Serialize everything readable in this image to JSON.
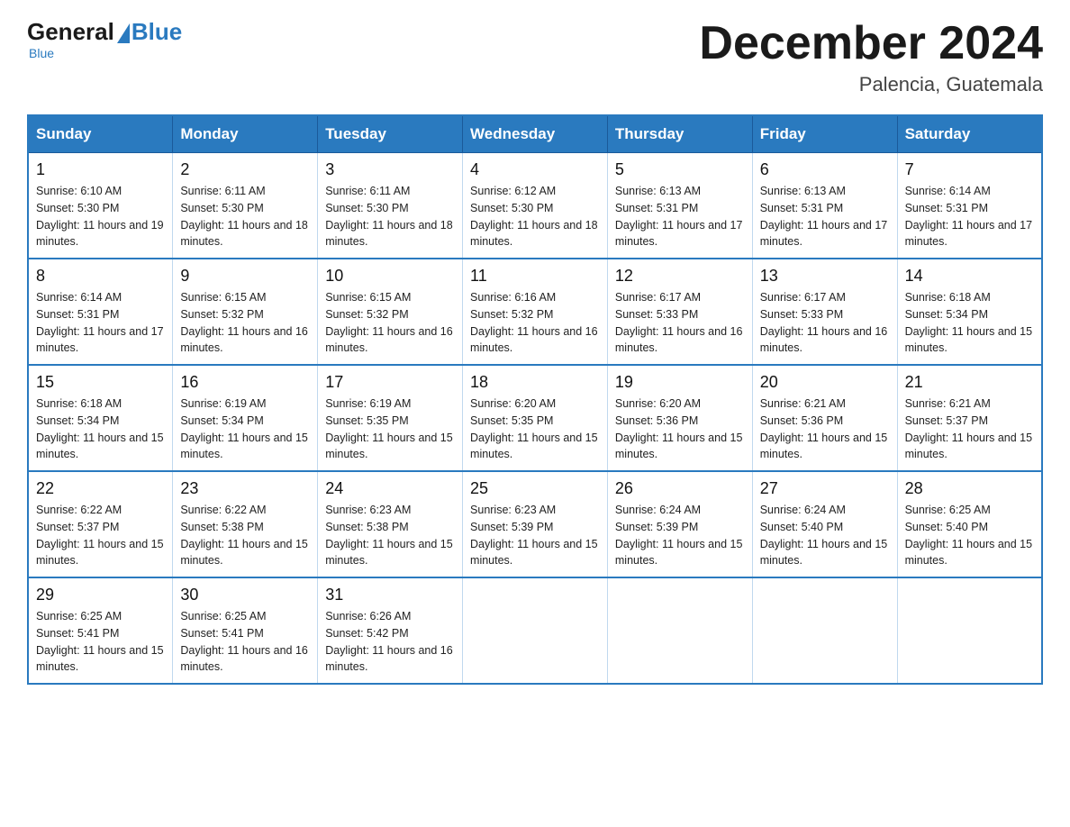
{
  "logo": {
    "general": "General",
    "blue": "Blue"
  },
  "title": "December 2024",
  "location": "Palencia, Guatemala",
  "days_header": [
    "Sunday",
    "Monday",
    "Tuesday",
    "Wednesday",
    "Thursday",
    "Friday",
    "Saturday"
  ],
  "weeks": [
    [
      {
        "day": "1",
        "sunrise": "6:10 AM",
        "sunset": "5:30 PM",
        "daylight": "11 hours and 19 minutes."
      },
      {
        "day": "2",
        "sunrise": "6:11 AM",
        "sunset": "5:30 PM",
        "daylight": "11 hours and 18 minutes."
      },
      {
        "day": "3",
        "sunrise": "6:11 AM",
        "sunset": "5:30 PM",
        "daylight": "11 hours and 18 minutes."
      },
      {
        "day": "4",
        "sunrise": "6:12 AM",
        "sunset": "5:30 PM",
        "daylight": "11 hours and 18 minutes."
      },
      {
        "day": "5",
        "sunrise": "6:13 AM",
        "sunset": "5:31 PM",
        "daylight": "11 hours and 17 minutes."
      },
      {
        "day": "6",
        "sunrise": "6:13 AM",
        "sunset": "5:31 PM",
        "daylight": "11 hours and 17 minutes."
      },
      {
        "day": "7",
        "sunrise": "6:14 AM",
        "sunset": "5:31 PM",
        "daylight": "11 hours and 17 minutes."
      }
    ],
    [
      {
        "day": "8",
        "sunrise": "6:14 AM",
        "sunset": "5:31 PM",
        "daylight": "11 hours and 17 minutes."
      },
      {
        "day": "9",
        "sunrise": "6:15 AM",
        "sunset": "5:32 PM",
        "daylight": "11 hours and 16 minutes."
      },
      {
        "day": "10",
        "sunrise": "6:15 AM",
        "sunset": "5:32 PM",
        "daylight": "11 hours and 16 minutes."
      },
      {
        "day": "11",
        "sunrise": "6:16 AM",
        "sunset": "5:32 PM",
        "daylight": "11 hours and 16 minutes."
      },
      {
        "day": "12",
        "sunrise": "6:17 AM",
        "sunset": "5:33 PM",
        "daylight": "11 hours and 16 minutes."
      },
      {
        "day": "13",
        "sunrise": "6:17 AM",
        "sunset": "5:33 PM",
        "daylight": "11 hours and 16 minutes."
      },
      {
        "day": "14",
        "sunrise": "6:18 AM",
        "sunset": "5:34 PM",
        "daylight": "11 hours and 15 minutes."
      }
    ],
    [
      {
        "day": "15",
        "sunrise": "6:18 AM",
        "sunset": "5:34 PM",
        "daylight": "11 hours and 15 minutes."
      },
      {
        "day": "16",
        "sunrise": "6:19 AM",
        "sunset": "5:34 PM",
        "daylight": "11 hours and 15 minutes."
      },
      {
        "day": "17",
        "sunrise": "6:19 AM",
        "sunset": "5:35 PM",
        "daylight": "11 hours and 15 minutes."
      },
      {
        "day": "18",
        "sunrise": "6:20 AM",
        "sunset": "5:35 PM",
        "daylight": "11 hours and 15 minutes."
      },
      {
        "day": "19",
        "sunrise": "6:20 AM",
        "sunset": "5:36 PM",
        "daylight": "11 hours and 15 minutes."
      },
      {
        "day": "20",
        "sunrise": "6:21 AM",
        "sunset": "5:36 PM",
        "daylight": "11 hours and 15 minutes."
      },
      {
        "day": "21",
        "sunrise": "6:21 AM",
        "sunset": "5:37 PM",
        "daylight": "11 hours and 15 minutes."
      }
    ],
    [
      {
        "day": "22",
        "sunrise": "6:22 AM",
        "sunset": "5:37 PM",
        "daylight": "11 hours and 15 minutes."
      },
      {
        "day": "23",
        "sunrise": "6:22 AM",
        "sunset": "5:38 PM",
        "daylight": "11 hours and 15 minutes."
      },
      {
        "day": "24",
        "sunrise": "6:23 AM",
        "sunset": "5:38 PM",
        "daylight": "11 hours and 15 minutes."
      },
      {
        "day": "25",
        "sunrise": "6:23 AM",
        "sunset": "5:39 PM",
        "daylight": "11 hours and 15 minutes."
      },
      {
        "day": "26",
        "sunrise": "6:24 AM",
        "sunset": "5:39 PM",
        "daylight": "11 hours and 15 minutes."
      },
      {
        "day": "27",
        "sunrise": "6:24 AM",
        "sunset": "5:40 PM",
        "daylight": "11 hours and 15 minutes."
      },
      {
        "day": "28",
        "sunrise": "6:25 AM",
        "sunset": "5:40 PM",
        "daylight": "11 hours and 15 minutes."
      }
    ],
    [
      {
        "day": "29",
        "sunrise": "6:25 AM",
        "sunset": "5:41 PM",
        "daylight": "11 hours and 15 minutes."
      },
      {
        "day": "30",
        "sunrise": "6:25 AM",
        "sunset": "5:41 PM",
        "daylight": "11 hours and 16 minutes."
      },
      {
        "day": "31",
        "sunrise": "6:26 AM",
        "sunset": "5:42 PM",
        "daylight": "11 hours and 16 minutes."
      },
      null,
      null,
      null,
      null
    ]
  ]
}
